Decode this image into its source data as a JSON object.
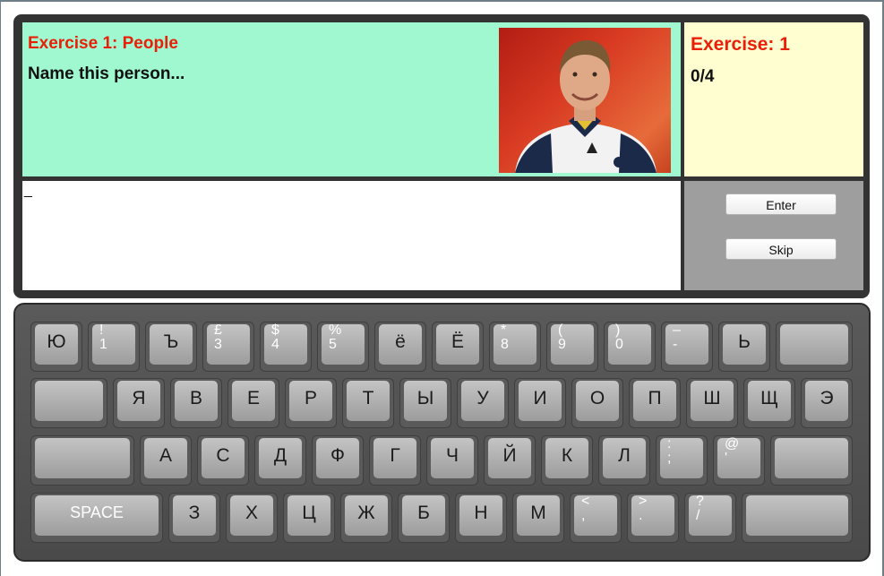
{
  "exercise": {
    "title": "Exercise 1: People",
    "prompt": "Name this person...",
    "photo_icon": "person-photo"
  },
  "score": {
    "title": "Exercise: 1",
    "value": "0/4"
  },
  "answer": {
    "value": "_"
  },
  "controls": {
    "enter_label": "Enter",
    "skip_label": "Skip"
  },
  "keyboard": {
    "rows": [
      [
        {
          "main": "Ю"
        },
        {
          "shift": "!",
          "base": "1"
        },
        {
          "main": "Ъ"
        },
        {
          "shift": "£",
          "base": "3"
        },
        {
          "shift": "$",
          "base": "4"
        },
        {
          "shift": "%",
          "base": "5"
        },
        {
          "main": "ё"
        },
        {
          "main": "Ë"
        },
        {
          "shift": "*",
          "base": "8"
        },
        {
          "shift": "(",
          "base": "9"
        },
        {
          "shift": ")",
          "base": "0"
        },
        {
          "shift": "–",
          "base": "-"
        },
        {
          "main": "Ь"
        },
        {}
      ],
      [
        {},
        {
          "main": "Я"
        },
        {
          "main": "В"
        },
        {
          "main": "Е"
        },
        {
          "main": "Р"
        },
        {
          "main": "Т"
        },
        {
          "main": "Ы"
        },
        {
          "main": "У"
        },
        {
          "main": "И"
        },
        {
          "main": "О"
        },
        {
          "main": "П"
        },
        {
          "main": "Ш"
        },
        {
          "main": "Щ"
        },
        {
          "main": "Э"
        }
      ],
      [
        {},
        {
          "main": "А"
        },
        {
          "main": "С"
        },
        {
          "main": "Д"
        },
        {
          "main": "Ф"
        },
        {
          "main": "Г"
        },
        {
          "main": "Ч"
        },
        {
          "main": "Й"
        },
        {
          "main": "К"
        },
        {
          "main": "Л"
        },
        {
          "shift": ":",
          "base": ";"
        },
        {
          "shift": "@",
          "base": "'"
        },
        {}
      ],
      [
        {
          "label": "SPACE"
        },
        {
          "main": "З"
        },
        {
          "main": "Х"
        },
        {
          "main": "Ц"
        },
        {
          "main": "Ж"
        },
        {
          "main": "Б"
        },
        {
          "main": "Н"
        },
        {
          "main": "М"
        },
        {
          "shift": "<",
          "base": ","
        },
        {
          "shift": ">",
          "base": "."
        },
        {
          "shift": "?",
          "base": "/"
        },
        {}
      ]
    ]
  }
}
